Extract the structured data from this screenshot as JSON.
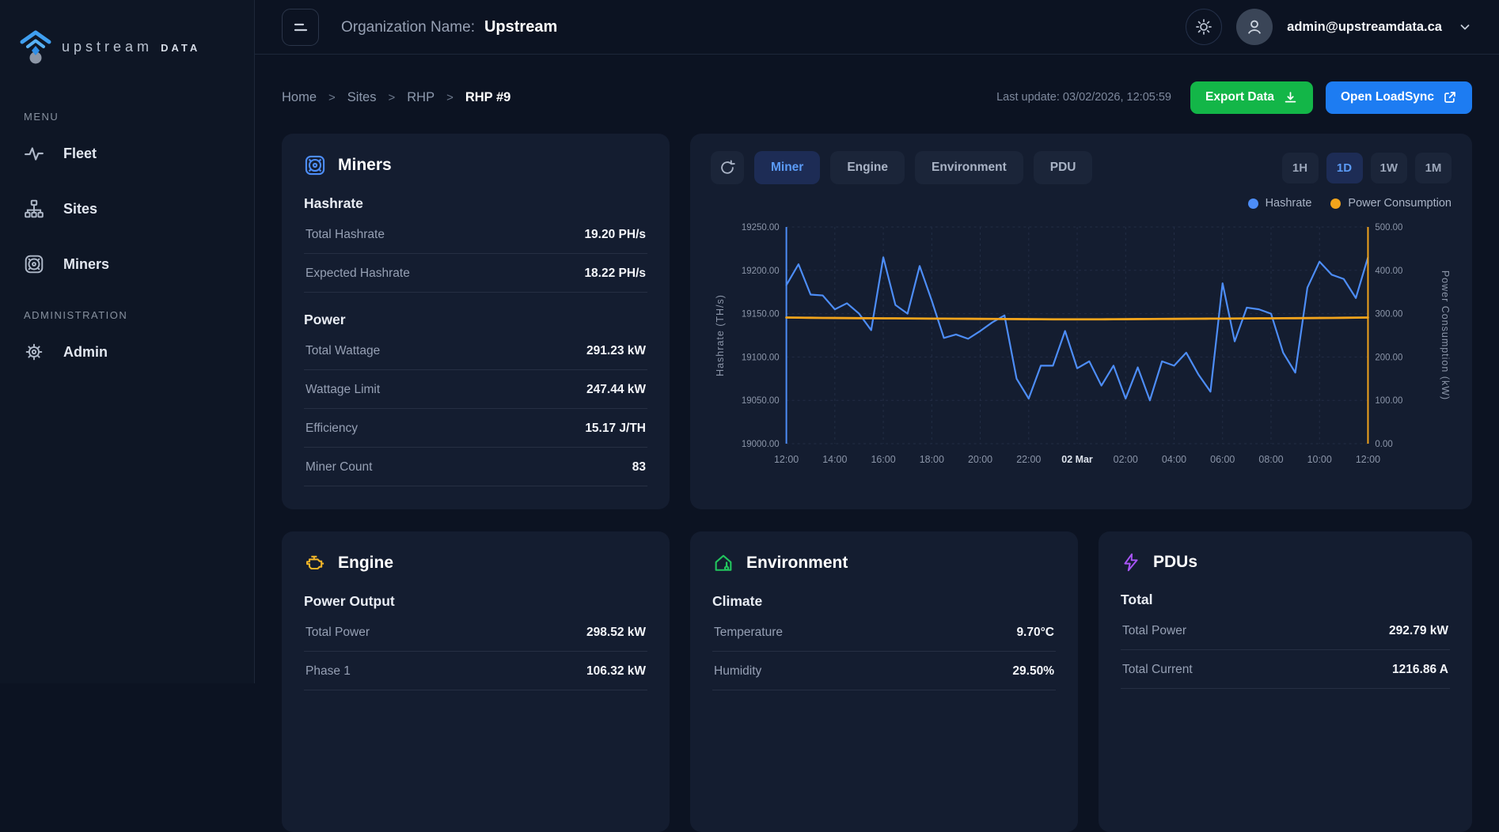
{
  "brand": {
    "name": "upstream",
    "suffix": "DATA"
  },
  "sidebar": {
    "menu_label": "MENU",
    "admin_label": "ADMINISTRATION",
    "items": [
      {
        "label": "Fleet",
        "icon": "activity-icon"
      },
      {
        "label": "Sites",
        "icon": "sitemap-icon"
      },
      {
        "label": "Miners",
        "icon": "fan-icon"
      }
    ],
    "admin_items": [
      {
        "label": "Admin",
        "icon": "gear-icon"
      }
    ]
  },
  "header": {
    "org_label": "Organization Name:",
    "org_value": "Upstream",
    "user_email": "admin@upstreamdata.ca"
  },
  "toolbar": {
    "breadcrumb": [
      "Home",
      "Sites",
      "RHP",
      "RHP #9"
    ],
    "separator": ">",
    "last_update": "Last update: 03/02/2026, 12:05:59",
    "export_label": "Export Data",
    "loadsync_label": "Open LoadSync"
  },
  "miners_card": {
    "title": "Miners",
    "sections": [
      {
        "heading": "Hashrate",
        "rows": [
          [
            "Total Hashrate",
            "19.20 PH/s"
          ],
          [
            "Expected Hashrate",
            "18.22 PH/s"
          ]
        ]
      },
      {
        "heading": "Power",
        "rows": [
          [
            "Total Wattage",
            "291.23 kW"
          ],
          [
            "Wattage Limit",
            "247.44 kW"
          ],
          [
            "Efficiency",
            "15.17 J/TH"
          ],
          [
            "Miner Count",
            "83"
          ]
        ]
      }
    ]
  },
  "chart_card": {
    "tabs": [
      "Miner",
      "Engine",
      "Environment",
      "PDU"
    ],
    "active_tab": "Miner",
    "ranges": [
      "1H",
      "1D",
      "1W",
      "1M"
    ],
    "active_range": "1D",
    "legend": [
      {
        "label": "Hashrate",
        "color": "#4d8df7"
      },
      {
        "label": "Power Consumption",
        "color": "#f2a41c"
      }
    ]
  },
  "chart_data": {
    "type": "line",
    "title": "Miner hashrate and power consumption over 1 day",
    "x_ticks": [
      "12:00",
      "14:00",
      "16:00",
      "18:00",
      "20:00",
      "22:00",
      "02 Mar",
      "02:00",
      "04:00",
      "06:00",
      "08:00",
      "10:00",
      "12:00"
    ],
    "bold_x_tick": "02 Mar",
    "grid": true,
    "left_axis": {
      "label": "Hashrate (TH/s)",
      "min": 19000,
      "max": 19250,
      "ticks": [
        19000,
        19050,
        19100,
        19150,
        19200,
        19250
      ],
      "decimals": 2
    },
    "right_axis": {
      "label": "Power Consumption (kW)",
      "min": 0,
      "max": 500,
      "ticks": [
        0,
        100,
        200,
        300,
        400,
        500
      ],
      "decimals": 2
    },
    "series": [
      {
        "name": "Hashrate",
        "axis": "left",
        "color": "#4d8df7",
        "edge_spike": "start",
        "values": [
          19183,
          19207,
          19172,
          19171,
          19155,
          19162,
          19150,
          19131,
          19215,
          19160,
          19150,
          19205,
          19165,
          19122,
          19126,
          19121,
          19130,
          19140,
          19148,
          19075,
          19052,
          19090,
          19090,
          19130,
          19087,
          19095,
          19067,
          19090,
          19052,
          19088,
          19050,
          19095,
          19090,
          19105,
          19080,
          19060,
          19185,
          19118,
          19157,
          19155,
          19150,
          19105,
          19082,
          19180,
          19210,
          19195,
          19190,
          19168,
          19215
        ]
      },
      {
        "name": "Power Consumption",
        "axis": "right",
        "color": "#f2a41c",
        "edge_spike": "end",
        "values": [
          291,
          290.8,
          290.5,
          290.2,
          290,
          289.8,
          289.6,
          289.5,
          289.3,
          289.2,
          289,
          288.8,
          288.6,
          288.5,
          288.3,
          288.2,
          288,
          287.8,
          287.6,
          287.5,
          287.3,
          287.2,
          287,
          287,
          287,
          287,
          287,
          287.2,
          287.3,
          287.5,
          287.6,
          287.8,
          288,
          288.2,
          288.3,
          288.5,
          288.6,
          288.8,
          289,
          289.2,
          289.3,
          289.5,
          289.6,
          289.8,
          290,
          290.2,
          290.5,
          290.8,
          291
        ]
      }
    ]
  },
  "engine_card": {
    "title": "Engine",
    "heading": "Power Output",
    "rows": [
      [
        "Total Power",
        "298.52 kW"
      ],
      [
        "Phase 1",
        "106.32 kW"
      ]
    ]
  },
  "environment_card": {
    "title": "Environment",
    "heading": "Climate",
    "rows": [
      [
        "Temperature",
        "9.70°C"
      ],
      [
        "Humidity",
        "29.50%"
      ]
    ]
  },
  "pdus_card": {
    "title": "PDUs",
    "heading": "Total",
    "rows": [
      [
        "Total Power",
        "292.79 kW"
      ],
      [
        "Total Current",
        "1216.86 A"
      ]
    ]
  },
  "colors": {
    "background": "#0c1322",
    "card": "#141d30",
    "accent_blue": "#4d8df7",
    "accent_orange": "#f2a41c",
    "export_green": "#13b648",
    "loadsync_blue": "#1d7cf2",
    "grid": "#222d44",
    "muted_text": "#96a0b4"
  }
}
